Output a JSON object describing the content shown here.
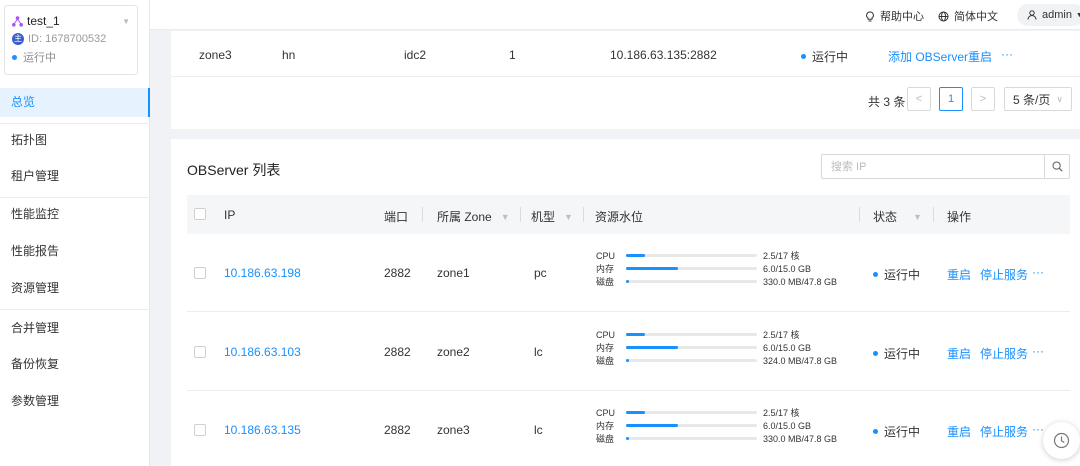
{
  "cluster": {
    "name": "test_1",
    "badge": "主",
    "id_text": "ID: 1678700532",
    "status": "运行中"
  },
  "nav": {
    "items": [
      {
        "label": "总览",
        "active": true
      },
      {
        "label": "拓扑图"
      },
      {
        "label": "租户管理"
      },
      {
        "label": "性能监控"
      },
      {
        "label": "性能报告"
      },
      {
        "label": "资源管理"
      },
      {
        "label": "合并管理"
      },
      {
        "label": "备份恢复"
      },
      {
        "label": "参数管理"
      }
    ]
  },
  "topbar": {
    "help": "帮助中心",
    "language": "简体中文",
    "user": "admin"
  },
  "zone_row": {
    "zone": "zone3",
    "region": "hn",
    "idc": "idc2",
    "count": "1",
    "root_server": "10.186.63.135:2882",
    "status": "运行中",
    "action_add": "添加 OBServer",
    "action_restart": "重启",
    "more": "···"
  },
  "pagination": {
    "total": "共 3 条",
    "prev": "<",
    "page": "1",
    "next": ">",
    "page_size": "5 条/页"
  },
  "observer_list": {
    "title": "OBServer 列表",
    "search_placeholder": "搜索 IP",
    "columns": {
      "ip": "IP",
      "port": "端口",
      "zone": "所属 Zone",
      "model": "机型",
      "resource": "资源水位",
      "status": "状态",
      "actions": "操作"
    },
    "rows": [
      {
        "ip": "10.186.63.198",
        "port": "2882",
        "zone": "zone1",
        "model": "pc",
        "cpu_label": "CPU",
        "cpu": "2.5/17 核",
        "cpu_ratio": 0.147,
        "mem_label": "内存",
        "mem": "6.0/15.0 GB",
        "mem_ratio": 0.4,
        "disk_label": "磁盘",
        "disk": "330.0 MB/47.8 GB",
        "disk_ratio": 0.007,
        "status": "运行中",
        "restart": "重启",
        "stop": "停止服务",
        "more": "···"
      },
      {
        "ip": "10.186.63.103",
        "port": "2882",
        "zone": "zone2",
        "model": "lc",
        "cpu_label": "CPU",
        "cpu": "2.5/17 核",
        "cpu_ratio": 0.147,
        "mem_label": "内存",
        "mem": "6.0/15.0 GB",
        "mem_ratio": 0.4,
        "disk_label": "磁盘",
        "disk": "324.0 MB/47.8 GB",
        "disk_ratio": 0.007,
        "status": "运行中",
        "restart": "重启",
        "stop": "停止服务",
        "more": "···"
      },
      {
        "ip": "10.186.63.135",
        "port": "2882",
        "zone": "zone3",
        "model": "lc",
        "cpu_label": "CPU",
        "cpu": "2.5/17 核",
        "cpu_ratio": 0.147,
        "mem_label": "内存",
        "mem": "6.0/15.0 GB",
        "mem_ratio": 0.4,
        "disk_label": "磁盘",
        "disk": "330.0 MB/47.8 GB",
        "disk_ratio": 0.007,
        "status": "运行中",
        "restart": "重启",
        "stop": "停止服务",
        "more": "···"
      }
    ]
  },
  "colors": {
    "accent": "#1890ff",
    "sidebar_active_bg": "#e6f3ff",
    "cluster_icon": "#a855f7"
  }
}
